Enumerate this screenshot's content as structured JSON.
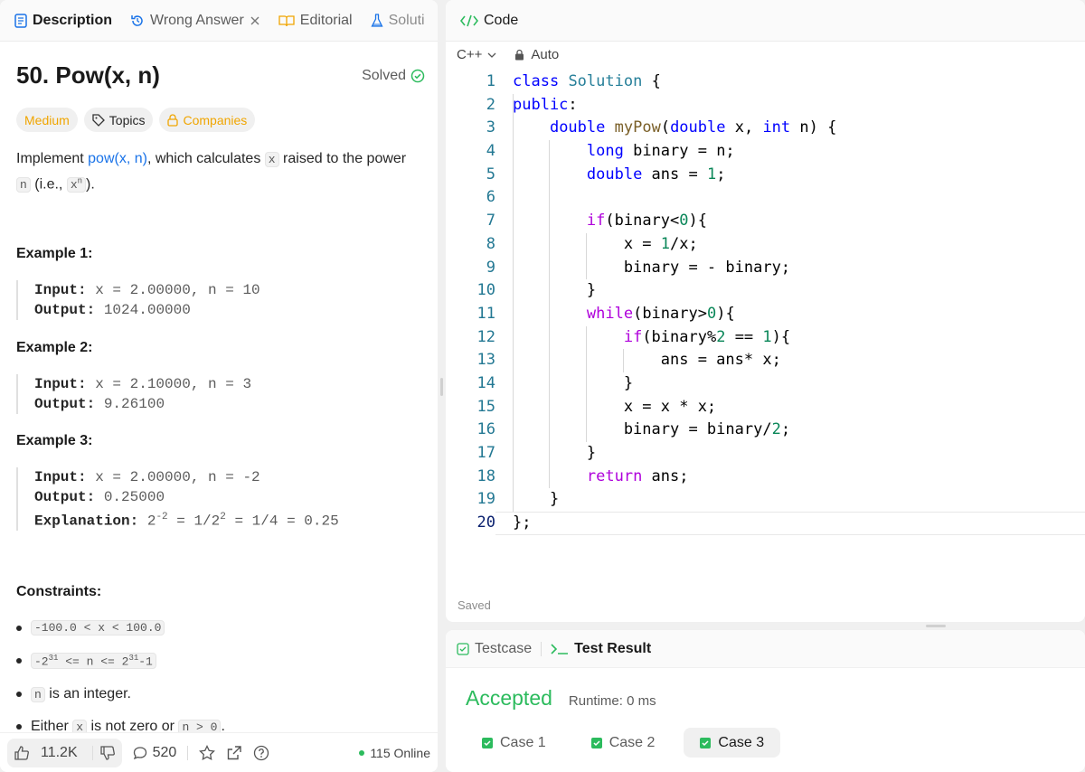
{
  "left_tabs": [
    {
      "label": "Description",
      "icon": "document-icon"
    },
    {
      "label": "Wrong Answer",
      "icon": "history-icon"
    },
    {
      "label": "Editorial",
      "icon": "book-icon"
    },
    {
      "label": "Soluti",
      "icon": "flask-icon"
    }
  ],
  "problem": {
    "title": "50. Pow(x, n)",
    "status": "Solved",
    "difficulty": "Medium",
    "topics": "Topics",
    "companies": "Companies",
    "desc_1": "Implement ",
    "desc_link": "pow(x, n)",
    "desc_2": ", which calculates ",
    "desc_x": "x",
    "desc_3": " raised to the power",
    "desc_n": "n",
    "desc_4": " (i.e., ",
    "desc_xn": "x",
    "desc_sup": "n",
    "desc_5": ")."
  },
  "examples": [
    {
      "header": "Example 1:",
      "input_label": "Input:",
      "input": "x = 2.00000, n = 10",
      "output_label": "Output:",
      "output": "1024.00000"
    },
    {
      "header": "Example 2:",
      "input_label": "Input:",
      "input": "x = 2.10000, n = 3",
      "output_label": "Output:",
      "output": "9.26100"
    },
    {
      "header": "Example 3:",
      "input_label": "Input:",
      "input": "x = 2.00000, n = -2",
      "output_label": "Output:",
      "output": "0.25000",
      "explanation_label": "Explanation:",
      "exp_a": "2",
      "exp_a_sup": "-2",
      "exp_b": " = 1/2",
      "exp_b_sup": "2",
      "exp_c": " = 1/4 = 0.25"
    }
  ],
  "constraints": {
    "header": "Constraints:",
    "c1": "-100.0 < x < 100.0",
    "c2_a": "-2",
    "c2_a_sup": "31",
    "c2_b": " <= n <= 2",
    "c2_b_sup": "31",
    "c2_c": "-1",
    "c3_code": "n",
    "c3_text": " is an integer.",
    "c4_a": "Either ",
    "c4_x": "x",
    "c4_b": " is not zero or ",
    "c4_c": "n > 0",
    "c4_d": "."
  },
  "bottom": {
    "likes": "11.2K",
    "comments": "520",
    "online": "115 Online"
  },
  "editor": {
    "title": "Code",
    "language": "C++",
    "mode": "Auto",
    "saved": "Saved",
    "line_numbers": [
      "1",
      "2",
      "3",
      "4",
      "5",
      "6",
      "7",
      "8",
      "9",
      "10",
      "11",
      "12",
      "13",
      "14",
      "15",
      "16",
      "17",
      "18",
      "19",
      "20"
    ]
  },
  "results": {
    "tab_testcase": "Testcase",
    "tab_result": "Test Result",
    "status": "Accepted",
    "runtime": "Runtime: 0 ms",
    "cases": [
      "Case 1",
      "Case 2",
      "Case 3"
    ]
  },
  "colors": {
    "accent_green": "#2cbb5d",
    "medium": "#f0a500",
    "link": "#1a73e8"
  }
}
